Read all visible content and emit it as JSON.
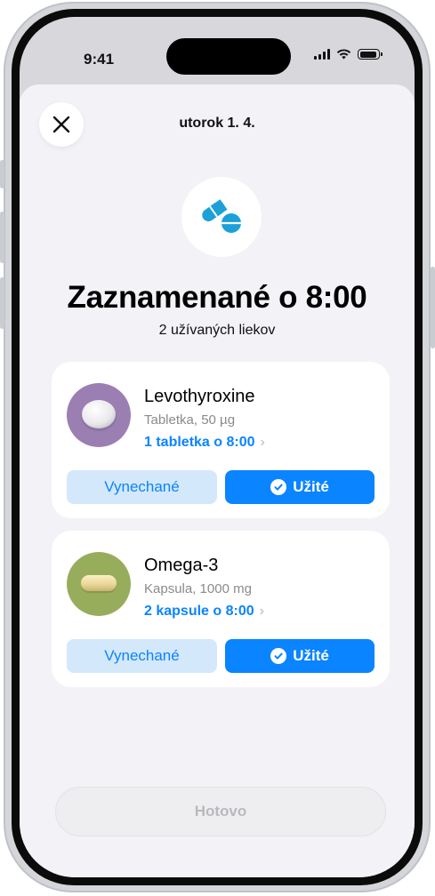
{
  "status_bar": {
    "time": "9:41"
  },
  "sheet": {
    "title": "utorok 1. 4.",
    "headline": "Zaznamenané o 8:00",
    "subhead": "2 užívaných liekov"
  },
  "medications": [
    {
      "name": "Levothyroxine",
      "dose": "Tabletka, 50 µg",
      "schedule": "1 tabletka o 8:00",
      "skip_label": "Vynechané",
      "taken_label": "Užité",
      "pill_color": "#9b7fb3"
    },
    {
      "name": "Omega-3",
      "dose": "Kapsula, 1000 mg",
      "schedule": "2 kapsule o 8:00",
      "skip_label": "Vynechané",
      "taken_label": "Užité",
      "pill_color": "#98ad5c"
    }
  ],
  "footer": {
    "done_label": "Hotovo"
  },
  "colors": {
    "accent": "#0a84ff",
    "skip_bg": "#d4e8fb",
    "sheet_bg": "#f2f2f7"
  },
  "icons": {
    "close": "close-icon",
    "header": "pills-icon",
    "check": "checkmark-icon",
    "chevron": "chevron-right-icon"
  }
}
